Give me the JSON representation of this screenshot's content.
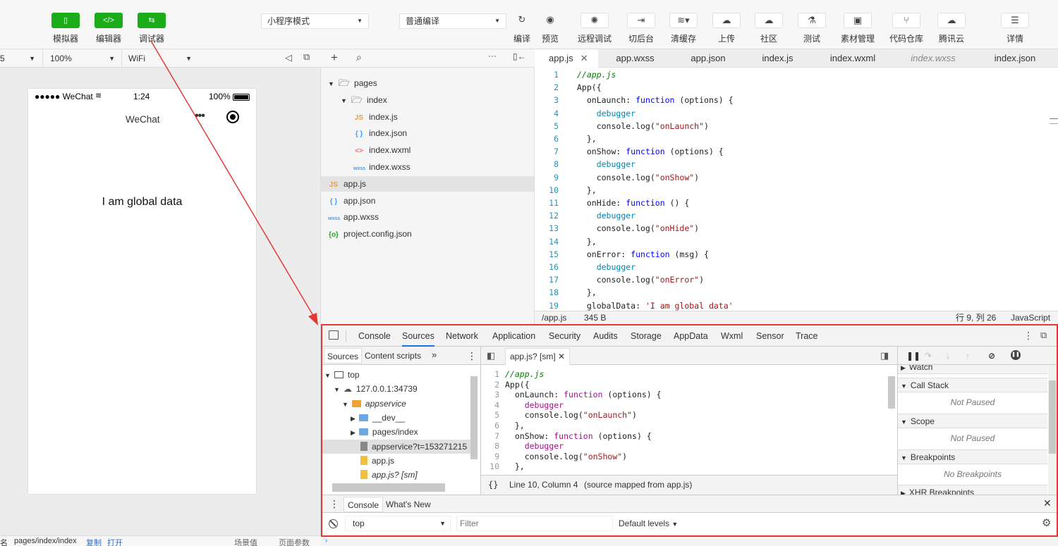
{
  "toolbar": {
    "left_buttons": [
      {
        "label": "模拟器",
        "icon": "phone-icon"
      },
      {
        "label": "编辑器",
        "icon": "code-icon"
      },
      {
        "label": "调试器",
        "icon": "debug-icon"
      }
    ],
    "mode_select": "小程序模式",
    "compile_select": "普通编译",
    "actions": [
      {
        "label": "编译",
        "icon": "refresh-icon"
      },
      {
        "label": "预览",
        "icon": "eye-icon"
      },
      {
        "label": "远程调试",
        "icon": "bug-icon"
      },
      {
        "label": "切后台",
        "icon": "switch-icon"
      },
      {
        "label": "清缓存",
        "icon": "layers-icon"
      },
      {
        "label": "上传",
        "icon": "upload-icon"
      },
      {
        "label": "社区",
        "icon": "community-icon"
      },
      {
        "label": "测试",
        "icon": "flask-icon"
      },
      {
        "label": "素材管理",
        "icon": "asset-icon"
      },
      {
        "label": "代码仓库",
        "icon": "git-icon"
      },
      {
        "label": "腾讯云",
        "icon": "cloud-icon"
      },
      {
        "label": "详情",
        "icon": "menu-icon"
      }
    ]
  },
  "simulator": {
    "device_select": "5",
    "zoom_select": "100%",
    "network_select": "WiFi",
    "status_carrier": "●●●●● WeChat",
    "status_time": "1:24",
    "status_battery": "100%",
    "nav_title": "WeChat",
    "content_text": "I am global data",
    "footer_left": "名",
    "footer_path": "pages/index/index",
    "footer_copy": "复制",
    "footer_open": "打开",
    "footer_scene": "场景值",
    "footer_params": "页面参数"
  },
  "file_tree": {
    "items": [
      {
        "label": "pages",
        "indent": 0,
        "type": "folder",
        "expanded": true
      },
      {
        "label": "index",
        "indent": 1,
        "type": "folder",
        "expanded": true
      },
      {
        "label": "index.js",
        "indent": 2,
        "type": "js"
      },
      {
        "label": "index.json",
        "indent": 2,
        "type": "json"
      },
      {
        "label": "index.wxml",
        "indent": 2,
        "type": "wxml"
      },
      {
        "label": "index.wxss",
        "indent": 2,
        "type": "wxss"
      },
      {
        "label": "app.js",
        "indent": 0,
        "type": "js",
        "selected": true
      },
      {
        "label": "app.json",
        "indent": 0,
        "type": "json"
      },
      {
        "label": "app.wxss",
        "indent": 0,
        "type": "wxss"
      },
      {
        "label": "project.config.json",
        "indent": 0,
        "type": "config"
      }
    ]
  },
  "editor": {
    "tabs": [
      "app.js",
      "app.wxss",
      "app.json",
      "index.js",
      "index.wxml",
      "index.wxss",
      "index.json"
    ],
    "active_tab": "app.js",
    "status_path": "/app.js",
    "status_size": "345 B",
    "status_pos": "行 9, 列 26",
    "status_lang": "JavaScript"
  },
  "devtools": {
    "tabs": [
      "Console",
      "Sources",
      "Network",
      "Application",
      "Security",
      "Audits",
      "Storage",
      "AppData",
      "Wxml",
      "Sensor",
      "Trace"
    ],
    "active_tab": "Sources",
    "nav_tabs": [
      "Sources",
      "Content scripts"
    ],
    "tree": [
      {
        "label": "top",
        "indent": 0
      },
      {
        "label": "127.0.0.1:34739",
        "indent": 1
      },
      {
        "label": "appservice",
        "indent": 2
      },
      {
        "label": "__dev__",
        "indent": 3
      },
      {
        "label": "pages/index",
        "indent": 3
      },
      {
        "label": "appservice?t=153271215",
        "indent": 3
      },
      {
        "label": "app.js",
        "indent": 3
      },
      {
        "label": "app.js? [sm]",
        "indent": 3
      }
    ],
    "open_file": "app.js? [sm]",
    "status": "Line 10, Column 4",
    "status_note": "(source mapped from app.js)",
    "sections": [
      {
        "title": "Watch",
        "body": ""
      },
      {
        "title": "Call Stack",
        "body": "Not Paused"
      },
      {
        "title": "Scope",
        "body": "Not Paused"
      },
      {
        "title": "Breakpoints",
        "body": "No Breakpoints"
      },
      {
        "title": "XHR Breakpoints",
        "body": ""
      }
    ],
    "drawer_tabs": [
      "Console",
      "What's New"
    ],
    "context": "top",
    "filter_placeholder": "Filter",
    "levels": "Default levels"
  }
}
